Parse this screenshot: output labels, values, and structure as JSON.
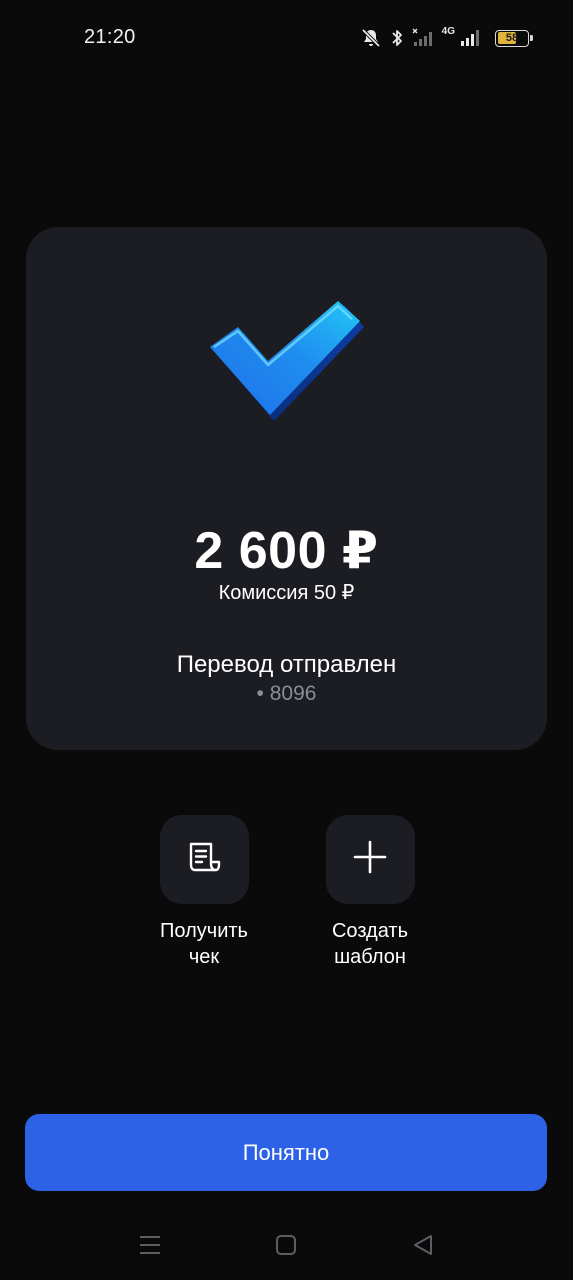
{
  "status_bar": {
    "time": "21:20",
    "network_label": "4G",
    "battery_level": "58",
    "icons": [
      "mute-bell-icon",
      "bluetooth-icon",
      "no-signal-icon",
      "signal-icon",
      "battery-icon"
    ]
  },
  "result": {
    "icon": "checkmark-icon",
    "amount": "2 600 ₽",
    "commission": "Комиссия 50 ₽",
    "status": "Перевод отправлен",
    "account": "• 8096"
  },
  "actions": [
    {
      "icon": "receipt-icon",
      "label": "Получить\nчек"
    },
    {
      "icon": "plus-icon",
      "label": "Создать\nшаблон"
    }
  ],
  "primary_button": {
    "label": "Понятно"
  },
  "nav_bar": {
    "icons": [
      "menu-icon",
      "home-icon",
      "back-icon"
    ]
  },
  "colors": {
    "background": "#0a0a0b",
    "card": "#1c1d22",
    "accent": "#2d62e6",
    "check_gradient_start": "#1f6fe8",
    "check_gradient_end": "#22c7f5"
  }
}
